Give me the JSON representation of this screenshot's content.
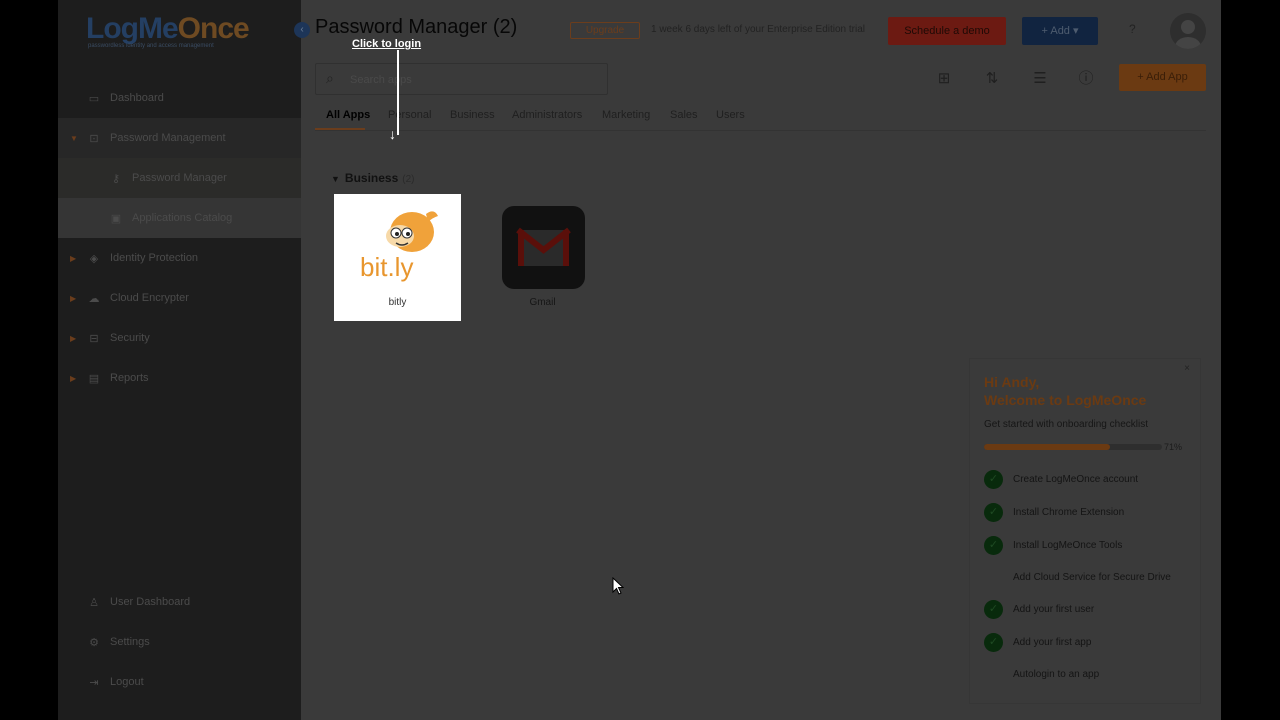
{
  "logo": {
    "part1": "LogMe",
    "part2": "Once",
    "tagline": "passwordless identity and access management"
  },
  "sidebar": {
    "items": [
      {
        "label": "Dashboard",
        "icon": "dashboard-icon"
      },
      {
        "label": "Password Management",
        "icon": "lock-icon"
      },
      {
        "label": "Password Manager",
        "icon": "key-icon"
      },
      {
        "label": "Applications Catalog",
        "icon": "catalog-icon"
      },
      {
        "label": "Identity Protection",
        "icon": "shield-icon"
      },
      {
        "label": "Cloud Encrypter",
        "icon": "cloud-icon"
      },
      {
        "label": "Security",
        "icon": "security-icon"
      },
      {
        "label": "Reports",
        "icon": "reports-icon"
      }
    ],
    "bottom": [
      {
        "label": "User Dashboard",
        "icon": "user-icon"
      },
      {
        "label": "Settings",
        "icon": "gear-icon"
      },
      {
        "label": "Logout",
        "icon": "logout-icon"
      }
    ]
  },
  "header": {
    "title": "Password Manager (2)",
    "upgrade": "Upgrade",
    "trial": "1 week 6 days left of your Enterprise Edition trial",
    "schedule_demo": "Schedule a demo",
    "add": "+ Add ▾",
    "help": "?"
  },
  "tooltip": {
    "click_to_login": "Click to login"
  },
  "search": {
    "placeholder": "Search apps"
  },
  "toolbar": {
    "add_app": "+ Add App"
  },
  "tabs": [
    "All Apps",
    "Personal",
    "Business",
    "Administrators",
    "Marketing",
    "Sales",
    "Users"
  ],
  "section": {
    "title": "Business",
    "count": "(2)"
  },
  "apps": [
    {
      "name": "bitly",
      "logo_text": "bit.ly"
    },
    {
      "name": "Gmail",
      "logo_text": "M"
    }
  ],
  "onboarding": {
    "greeting": "Hi Andy,",
    "welcome": "Welcome to LogMeOnce",
    "subtitle": "Get started with onboarding checklist",
    "progress": 0.71,
    "progress_label": "71%",
    "items": [
      {
        "label": "Create LogMeOnce account",
        "done": true
      },
      {
        "label": "Install Chrome Extension",
        "done": true
      },
      {
        "label": "Install LogMeOnce Tools",
        "done": true
      },
      {
        "label": "Add Cloud Service for Secure Drive",
        "done": false
      },
      {
        "label": "Add your first user",
        "done": true
      },
      {
        "label": "Add your first app",
        "done": true
      },
      {
        "label": "Autologin to an app",
        "done": false
      }
    ],
    "close": "×"
  },
  "colors": {
    "accent_orange": "#e87722",
    "brand_blue": "#1a3d6d",
    "demo_red": "#d8372a"
  }
}
